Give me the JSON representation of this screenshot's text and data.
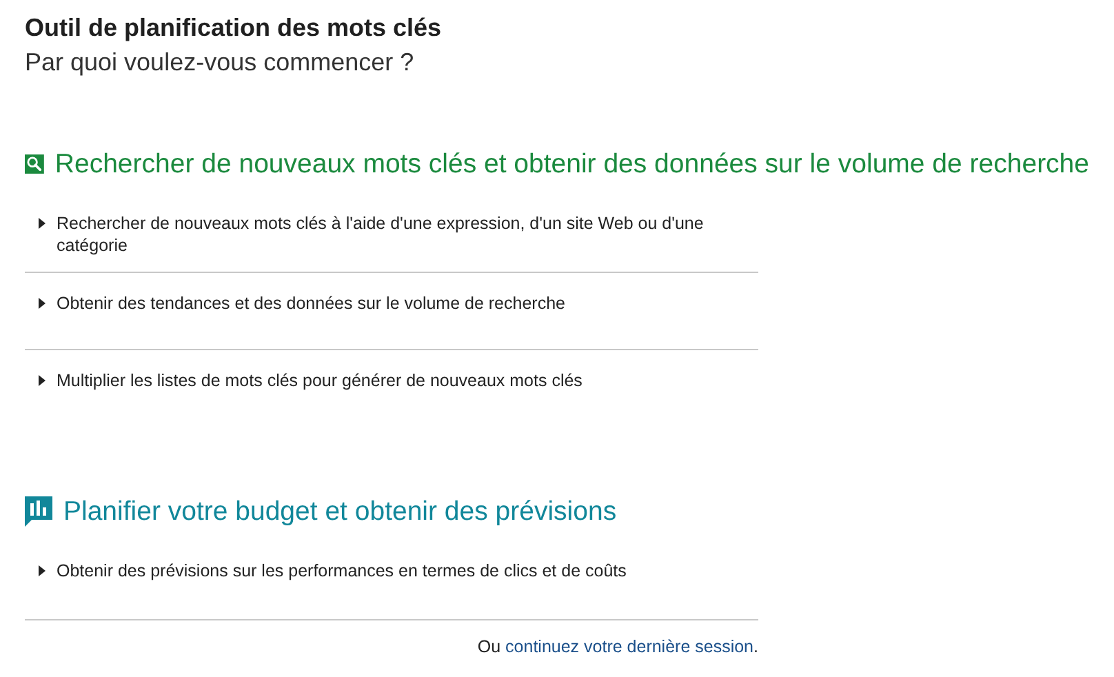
{
  "title": "Outil de planification des mots clés",
  "subtitle": "Par quoi voulez-vous commencer ?",
  "sections": [
    {
      "kind": "search",
      "color": "#1b8a3e",
      "heading": "Rechercher de nouveaux mots clés et obtenir des données sur le volume de recherche",
      "items": [
        {
          "label": "Rechercher de nouveaux mots clés à l'aide d'une expression, d'un site Web ou d'une catégorie"
        },
        {
          "label": "Obtenir des tendances et des données sur le volume de recherche"
        },
        {
          "label": "Multiplier les listes de mots clés pour générer de nouveaux mots clés"
        }
      ]
    },
    {
      "kind": "forecast",
      "color": "#11879a",
      "heading": "Planifier votre budget et obtenir des prévisions",
      "items": [
        {
          "label": "Obtenir des prévisions sur les performances en termes de clics et de coûts"
        }
      ]
    }
  ],
  "footer": {
    "prefix": "Ou ",
    "link": "continuez votre dernière session",
    "suffix": "."
  }
}
